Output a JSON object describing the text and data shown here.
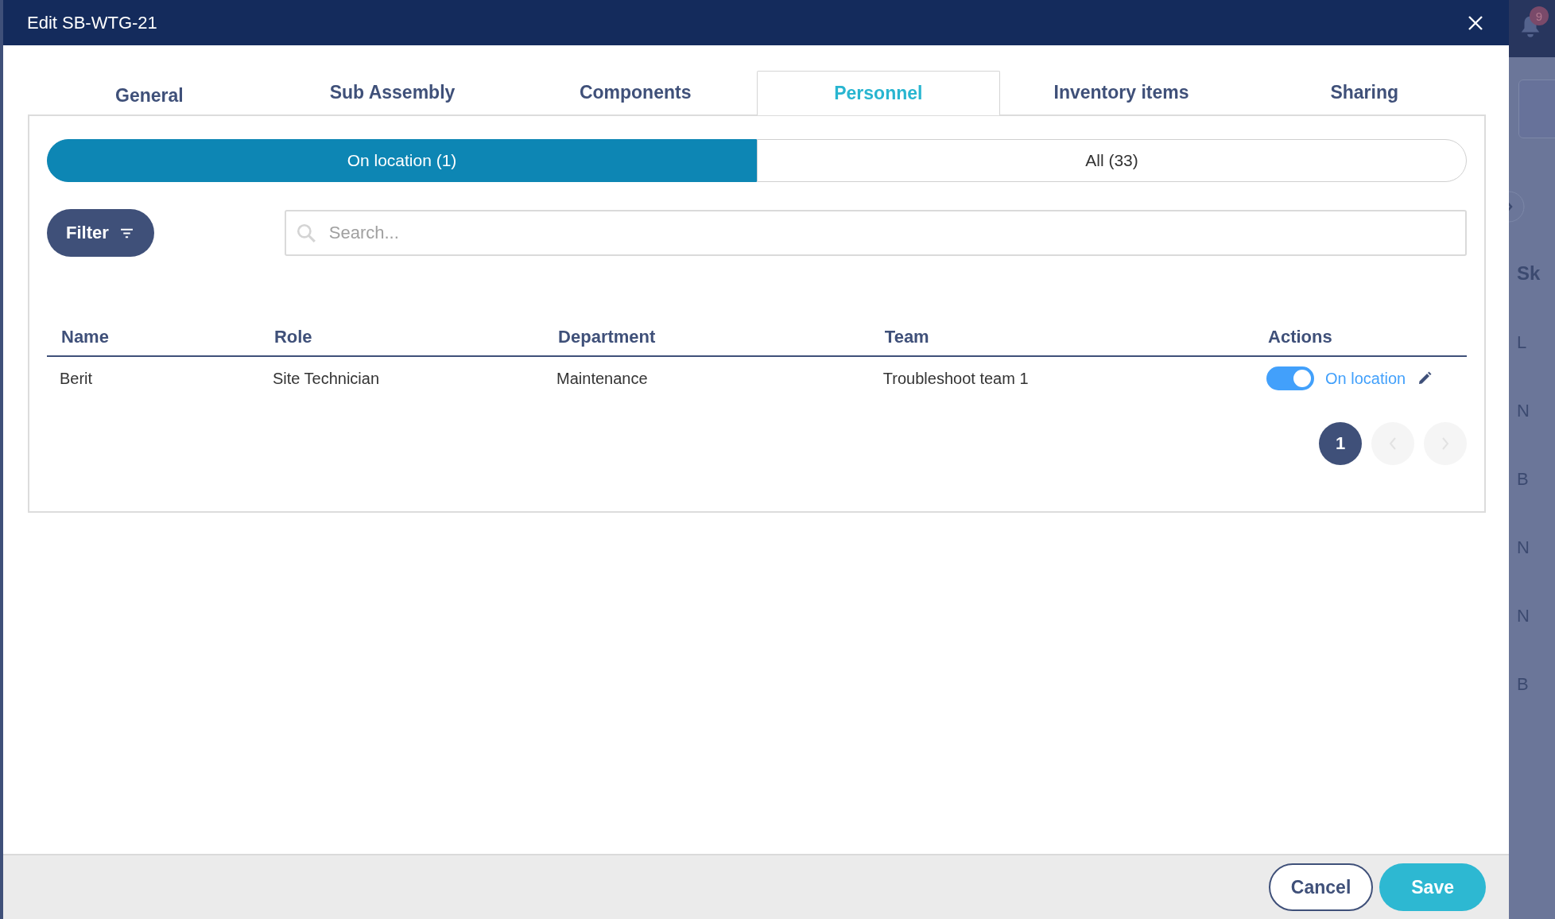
{
  "window": {
    "title": "Edit SB-WTG-21"
  },
  "tabs": [
    {
      "label": "General",
      "selected": false
    },
    {
      "label": "Sub Assembly",
      "selected": false
    },
    {
      "label": "Components",
      "selected": false
    },
    {
      "label": "Personnel",
      "selected": true
    },
    {
      "label": "Inventory items",
      "selected": false
    },
    {
      "label": "Sharing",
      "selected": false
    }
  ],
  "segments": [
    {
      "label": "On location (1)",
      "selected": true
    },
    {
      "label": "All (33)",
      "selected": false
    }
  ],
  "filter_button": "Filter",
  "search": {
    "placeholder": "Search..."
  },
  "table": {
    "columns": [
      "Name",
      "Role",
      "Department",
      "Team",
      "Actions"
    ],
    "rows": [
      {
        "name": "Berit",
        "role": "Site Technician",
        "department": "Maintenance",
        "team": "Troubleshoot team 1",
        "on_location": true,
        "status": "On location"
      }
    ]
  },
  "pagination": {
    "pages": [
      {
        "label": "1",
        "selected": true
      }
    ],
    "prev_disabled": true,
    "next_disabled": true
  },
  "footer": {
    "buttons": [
      {
        "label": "Cancel",
        "kind": "secondary"
      },
      {
        "label": "Save",
        "kind": "primary"
      }
    ]
  },
  "background": {
    "notification_count": "9",
    "fragments": [
      "Sk",
      "L",
      "N",
      "B",
      "N",
      "N",
      "B"
    ]
  }
}
